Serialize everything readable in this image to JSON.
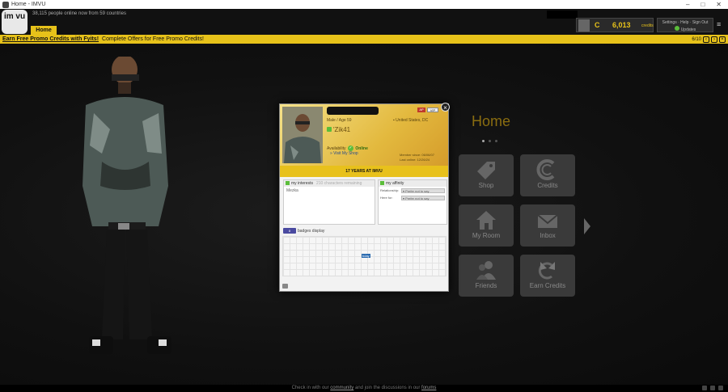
{
  "window": {
    "title": "Home - IMVU",
    "controls": [
      "–",
      "□",
      "✕"
    ]
  },
  "header": {
    "logo_text": "im vu",
    "online_text": "38,115 people online now from 59 countries",
    "home_tab": "Home",
    "credits": {
      "value": "6,013",
      "label": "credits",
      "currency_icon": "C"
    },
    "user_box": {
      "line1": "Settings · Help · Sign Out",
      "line2": "Updates"
    }
  },
  "promo": {
    "link_text": "Earn Free Promo Credits with Fyits!",
    "text": "Complete Offers for Free Promo Credits!",
    "page": "6/10"
  },
  "home": {
    "title": "Home",
    "tiles": [
      {
        "label": "Shop",
        "icon": "tag-icon"
      },
      {
        "label": "Credits",
        "icon": "credits-icon"
      },
      {
        "label": "My Room",
        "icon": "house-icon"
      },
      {
        "label": "Inbox",
        "icon": "envelope-icon"
      },
      {
        "label": "Friends",
        "icon": "people-icon"
      },
      {
        "label": "Earn Credits",
        "icon": "earn-credits-icon"
      }
    ]
  },
  "profile_card": {
    "ap_label": "AP",
    "vip_label": "VIP",
    "gender_age": "Male / Age 59",
    "location": "United States, DC",
    "tagline": "'Zik41",
    "availability_label": "Availability",
    "availability_value": "Online",
    "visit_shop": "Visit My Shop",
    "member_since": "Member since: 06/06/07",
    "last_online": "Last online: 12/26/24",
    "years_banner": "17 YEARS AT IMVU",
    "interests": {
      "header": "my interests",
      "remaining": "210 characters remaining",
      "value": "Mezka"
    },
    "affinity": {
      "header": "my affinity",
      "rows": [
        {
          "key": "Relationship:",
          "value": "Prefer not to say"
        },
        {
          "key": "Here for:",
          "value": "Prefer not to say"
        }
      ]
    },
    "badges": {
      "header": "badges display",
      "icon_label": "8",
      "badge_label": "bday"
    }
  },
  "footer": {
    "text_before": "Check in with our",
    "link1": "community",
    "text_middle": "and join the discussions in our",
    "link2": "forums"
  },
  "colors": {
    "accent": "#e7c21a",
    "background": "#0b0b0b",
    "tile": "#3a3a3a"
  }
}
